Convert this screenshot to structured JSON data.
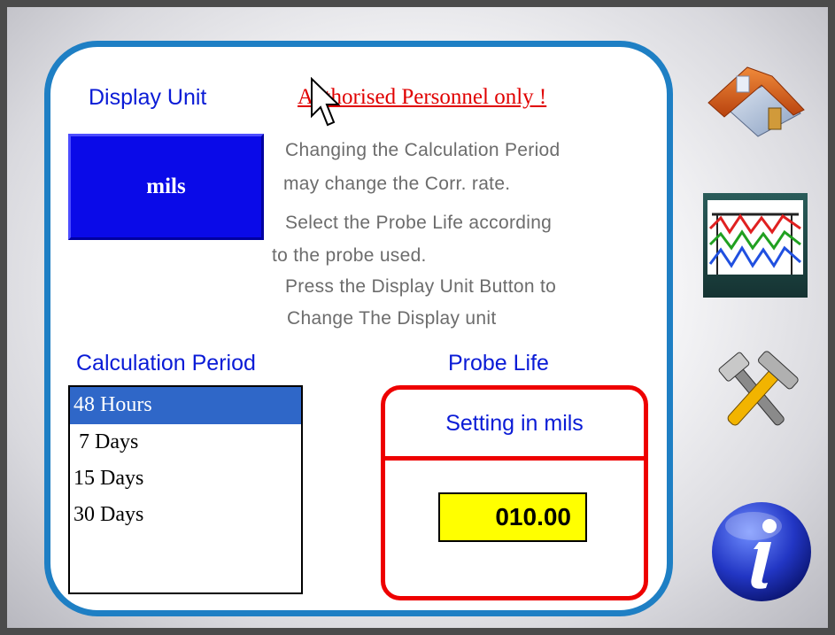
{
  "display_unit": {
    "label": "Display Unit",
    "value": "mils"
  },
  "warning": "Authorised Personnel only !",
  "help_lines": [
    "Changing the Calculation Period",
    "may change the Corr. rate.",
    "Select the Probe Life according",
    "to the probe used.",
    "Press the Display Unit Button to",
    "Change The Display unit"
  ],
  "calculation_period": {
    "label": "Calculation Period",
    "options": [
      "48 Hours",
      " 7 Days",
      "15 Days",
      "30 Days"
    ],
    "selected": "48 Hours"
  },
  "probe_life": {
    "label": "Probe Life",
    "setting_label": "Setting in mils",
    "value": "010.00"
  },
  "side_nav": [
    "home-icon",
    "trend-chart-icon",
    "tools-icon",
    "info-icon"
  ],
  "colors": {
    "panel_border": "#1e7fc4",
    "label_blue": "#0a1bd6",
    "unit_button": "#0a0ae8",
    "warning_red": "#e00000",
    "probe_border": "#ee0000",
    "value_bg": "#ffff00",
    "selected_row": "#2f67c8"
  }
}
